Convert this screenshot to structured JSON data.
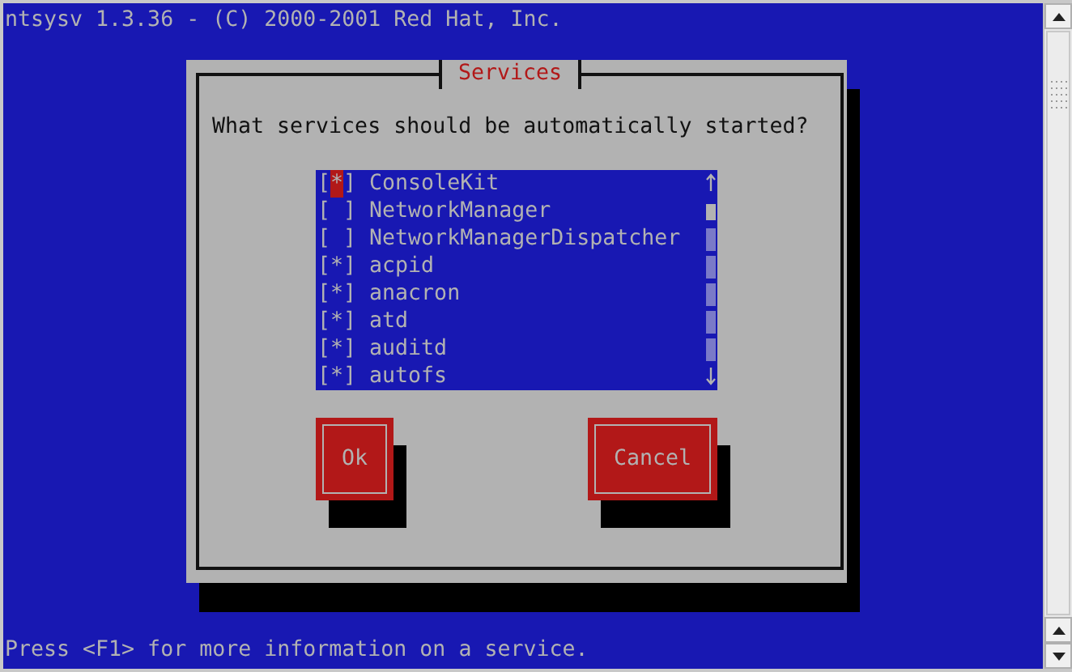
{
  "title_line": "ntsysv 1.3.36 - (C) 2000-2001 Red Hat, Inc.",
  "dialog": {
    "title": "Services",
    "question": "What services should be automatically started?",
    "services": [
      {
        "checkbox": "[*]",
        "name": "ConsoleKit",
        "focused": true
      },
      {
        "checkbox": "[ ]",
        "name": "NetworkManager",
        "focused": false
      },
      {
        "checkbox": "[ ]",
        "name": "NetworkManagerDispatcher",
        "focused": false
      },
      {
        "checkbox": "[*]",
        "name": "acpid",
        "focused": false
      },
      {
        "checkbox": "[*]",
        "name": "anacron",
        "focused": false
      },
      {
        "checkbox": "[*]",
        "name": "atd",
        "focused": false
      },
      {
        "checkbox": "[*]",
        "name": "auditd",
        "focused": false
      },
      {
        "checkbox": "[*]",
        "name": "autofs",
        "focused": false
      }
    ],
    "buttons": [
      {
        "label": "Ok",
        "kind": "ok"
      },
      {
        "label": "Cancel",
        "kind": "cancel"
      }
    ]
  },
  "status_line": "Press <F1> for more information on a service."
}
